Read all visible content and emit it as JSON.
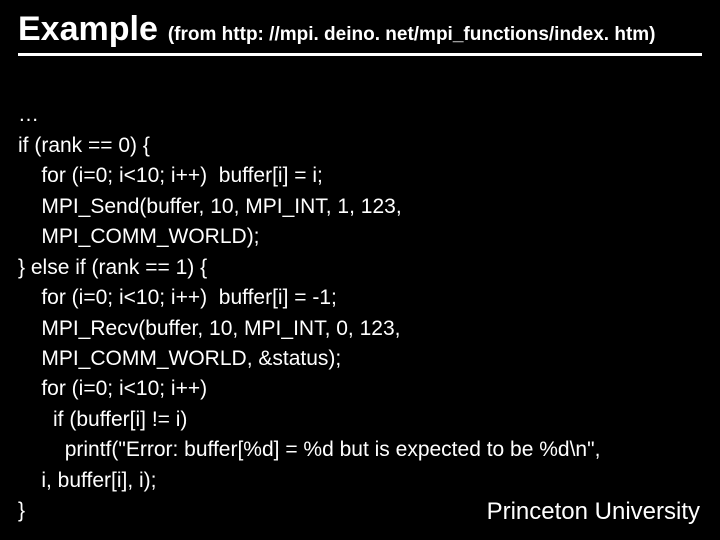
{
  "header": {
    "title": "Example",
    "subtitle": "(from http: //mpi. deino. net/mpi_functions/index. htm)"
  },
  "code_lines": {
    "l0": "…",
    "l1": "if (rank == 0) {",
    "l2": "    for (i=0; i<10; i++)  buffer[i] = i;",
    "l3": "    MPI_Send(buffer, 10, MPI_INT, 1, 123,",
    "l4": "    MPI_COMM_WORLD);",
    "l5": "} else if (rank == 1) {",
    "l6": "    for (i=0; i<10; i++)  buffer[i] = -1;",
    "l7": "    MPI_Recv(buffer, 10, MPI_INT, 0, 123,",
    "l8": "    MPI_COMM_WORLD, &status);",
    "l9": "    for (i=0; i<10; i++)",
    "l10": "      if (buffer[i] != i)",
    "l11": "        printf(\"Error: buffer[%d] = %d but is expected to be %d\\n\",",
    "l12": "    i, buffer[i], i);",
    "l13": "}"
  },
  "footer": {
    "text": "Princeton University"
  }
}
